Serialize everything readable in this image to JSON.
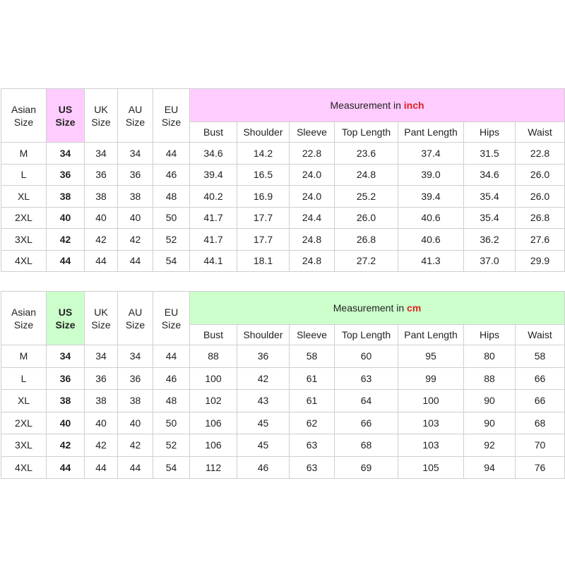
{
  "size_headers": {
    "asian": [
      "Asian",
      "Size"
    ],
    "us": [
      "US",
      "Size"
    ],
    "uk": [
      "UK",
      "Size"
    ],
    "au": [
      "AU",
      "Size"
    ],
    "eu": [
      "EU",
      "Size"
    ]
  },
  "measure_headers": [
    "Bust",
    "Shoulder",
    "Sleeve",
    "Top Length",
    "Pant Length",
    "Hips",
    "Waist"
  ],
  "colors": {
    "inch_band": "#ffccff",
    "cm_band": "#ccffcc",
    "unit_accent": "#e02020"
  },
  "chart_data": [
    {
      "type": "table",
      "title_prefix": "Measurement in ",
      "unit": "inch",
      "columns": [
        "Asian Size",
        "US Size",
        "UK Size",
        "AU Size",
        "EU Size",
        "Bust",
        "Shoulder",
        "Sleeve",
        "Top Length",
        "Pant Length",
        "Hips",
        "Waist"
      ],
      "rows": [
        [
          "M",
          "34",
          "34",
          "34",
          "44",
          "34.6",
          "14.2",
          "22.8",
          "23.6",
          "37.4",
          "31.5",
          "22.8"
        ],
        [
          "L",
          "36",
          "36",
          "36",
          "46",
          "39.4",
          "16.5",
          "24.0",
          "24.8",
          "39.0",
          "34.6",
          "26.0"
        ],
        [
          "XL",
          "38",
          "38",
          "38",
          "48",
          "40.2",
          "16.9",
          "24.0",
          "25.2",
          "39.4",
          "35.4",
          "26.0"
        ],
        [
          "2XL",
          "40",
          "40",
          "40",
          "50",
          "41.7",
          "17.7",
          "24.4",
          "26.0",
          "40.6",
          "35.4",
          "26.8"
        ],
        [
          "3XL",
          "42",
          "42",
          "42",
          "52",
          "41.7",
          "17.7",
          "24.8",
          "26.8",
          "40.6",
          "36.2",
          "27.6"
        ],
        [
          "4XL",
          "44",
          "44",
          "44",
          "54",
          "44.1",
          "18.1",
          "24.8",
          "27.2",
          "41.3",
          "37.0",
          "29.9"
        ]
      ]
    },
    {
      "type": "table",
      "title_prefix": "Measurement in ",
      "unit": "cm",
      "columns": [
        "Asian Size",
        "US Size",
        "UK Size",
        "AU Size",
        "EU Size",
        "Bust",
        "Shoulder",
        "Sleeve",
        "Top Length",
        "Pant Length",
        "Hips",
        "Waist"
      ],
      "rows": [
        [
          "M",
          "34",
          "34",
          "34",
          "44",
          "88",
          "36",
          "58",
          "60",
          "95",
          "80",
          "58"
        ],
        [
          "L",
          "36",
          "36",
          "36",
          "46",
          "100",
          "42",
          "61",
          "63",
          "99",
          "88",
          "66"
        ],
        [
          "XL",
          "38",
          "38",
          "38",
          "48",
          "102",
          "43",
          "61",
          "64",
          "100",
          "90",
          "66"
        ],
        [
          "2XL",
          "40",
          "40",
          "40",
          "50",
          "106",
          "45",
          "62",
          "66",
          "103",
          "90",
          "68"
        ],
        [
          "3XL",
          "42",
          "42",
          "42",
          "52",
          "106",
          "45",
          "63",
          "68",
          "103",
          "92",
          "70"
        ],
        [
          "4XL",
          "44",
          "44",
          "44",
          "54",
          "112",
          "46",
          "63",
          "69",
          "105",
          "94",
          "76"
        ]
      ]
    }
  ]
}
